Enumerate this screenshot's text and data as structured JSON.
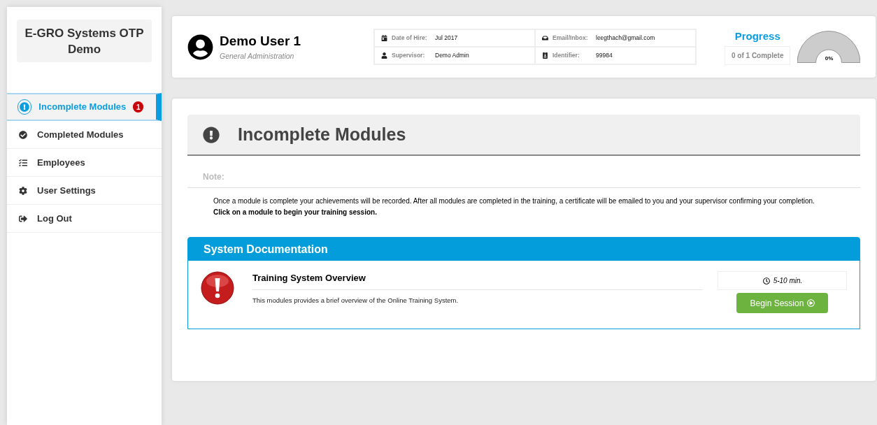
{
  "sidebar": {
    "title": "E-GRO Systems OTP Demo",
    "items": [
      {
        "label": "Incomplete Modules",
        "kind": "incomplete",
        "selected": true,
        "badge": "1"
      },
      {
        "label": "Completed Modules",
        "kind": "completed",
        "selected": false
      },
      {
        "label": "Employees",
        "kind": "employees",
        "selected": false
      },
      {
        "label": "User Settings",
        "kind": "settings",
        "selected": false
      },
      {
        "label": "Log Out",
        "kind": "logout",
        "selected": false
      }
    ]
  },
  "profile": {
    "name": "Demo User 1",
    "department": "General Administration",
    "details": [
      {
        "kind": "calendar",
        "label": "Date of Hire:",
        "value": "Jul 2017"
      },
      {
        "kind": "inbox",
        "label": "Email/Inbox:",
        "value": "leegthach@gmail.com"
      },
      {
        "kind": "user",
        "label": "Supervisor:",
        "value": "Demo Admin"
      },
      {
        "kind": "id",
        "label": "Identifier:",
        "value": "99984"
      }
    ],
    "progress": {
      "title": "Progress",
      "count": "0 of 1 Complete",
      "reading": "0%"
    }
  },
  "page": {
    "title": "Incomplete Modules",
    "note_label": "Note:",
    "note": "Once a module is complete your achievements will be recorded. After all modules are completed in the training, a certificate will be emailed to you and your supervisor confirming your completion.",
    "note_bold": "Click on a module to begin your training session.",
    "sections": [
      {
        "title": "System Documentation",
        "modules": [
          {
            "title": "Training System Overview",
            "description": "This modules provides a brief overview of the Online Training System.",
            "duration": "5-10 min.",
            "button": "Begin Session"
          }
        ]
      }
    ]
  }
}
